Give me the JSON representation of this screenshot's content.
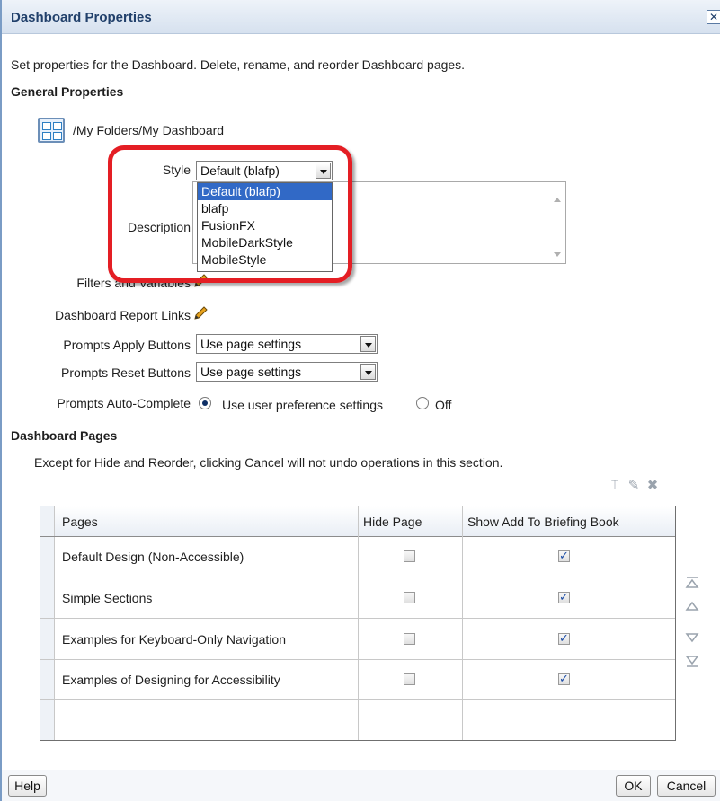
{
  "dialog": {
    "title": "Dashboard Properties",
    "close_label": "x"
  },
  "intro": "Set properties for the Dashboard. Delete, rename, and reorder Dashboard pages.",
  "general": {
    "heading": "General Properties",
    "path": "/My Folders/My Dashboard",
    "style_label": "Style",
    "style_value": "Default (blafp)",
    "style_options": [
      "Default (blafp)",
      "blafp",
      "FusionFX",
      "MobileDarkStyle",
      "MobileStyle"
    ],
    "description_label": "Description",
    "filters_label": "Filters and Variables",
    "report_links_label": "Dashboard Report Links",
    "apply_label": "Prompts Apply Buttons",
    "apply_value": "Use page settings",
    "reset_label": "Prompts Reset Buttons",
    "reset_value": "Use page settings",
    "autocomplete_label": "Prompts Auto-Complete",
    "autocomplete_opt1": "Use user preference settings",
    "autocomplete_opt2": "Off"
  },
  "pages": {
    "heading": "Dashboard Pages",
    "note": "Except for Hide and Reorder, clicking Cancel will not undo operations in this section.",
    "columns": [
      "Pages",
      "Hide Page",
      "Show Add To Briefing Book"
    ],
    "rows": [
      {
        "name": "Default Design (Non-Accessible)",
        "hide": false,
        "briefing": true
      },
      {
        "name": "Simple Sections",
        "hide": false,
        "briefing": true
      },
      {
        "name": "Examples for Keyboard-Only Navigation",
        "hide": false,
        "briefing": true
      },
      {
        "name": "Examples of Designing for Accessibility",
        "hide": false,
        "briefing": true
      }
    ]
  },
  "footer": {
    "help": "Help",
    "ok": "OK",
    "cancel": "Cancel"
  },
  "colors": {
    "highlight": "#e41e24",
    "selected_option": "#3169c6",
    "title_text": "#21406b"
  }
}
